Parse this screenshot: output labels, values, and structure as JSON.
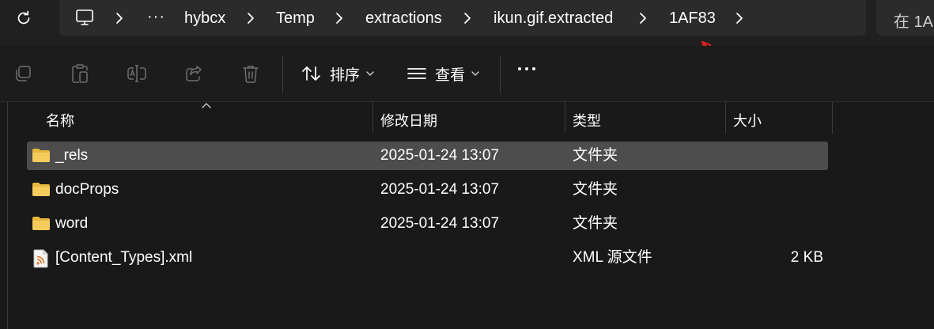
{
  "breadcrumb": {
    "more": "···",
    "items": [
      "hybcx",
      "Temp",
      "extractions",
      "ikun.gif.extracted",
      "1AF83"
    ]
  },
  "search": {
    "placeholder": "在 1A"
  },
  "toolbar": {
    "sort_label": "排序",
    "view_label": "查看"
  },
  "columns": {
    "name": "名称",
    "modified": "修改日期",
    "type": "类型",
    "size": "大小"
  },
  "files": [
    {
      "name": "_rels",
      "modified": "2025-01-24 13:07",
      "type": "文件夹",
      "size": "",
      "icon": "folder-icon",
      "selected": true
    },
    {
      "name": "docProps",
      "modified": "2025-01-24 13:07",
      "type": "文件夹",
      "size": "",
      "icon": "folder-icon",
      "selected": false
    },
    {
      "name": "word",
      "modified": "2025-01-24 13:07",
      "type": "文件夹",
      "size": "",
      "icon": "folder-icon",
      "selected": false
    },
    {
      "name": "[Content_Types].xml",
      "modified": "",
      "type": "XML 源文件",
      "size": "2 KB",
      "icon": "xml-file-icon",
      "selected": false
    }
  ],
  "colors": {
    "background": "#1c1c1c",
    "address_bar": "#2b2b2b",
    "selected_row": "#4d4d4d",
    "folder": "#f0c34d",
    "annotation_arrow": "#e02020"
  }
}
